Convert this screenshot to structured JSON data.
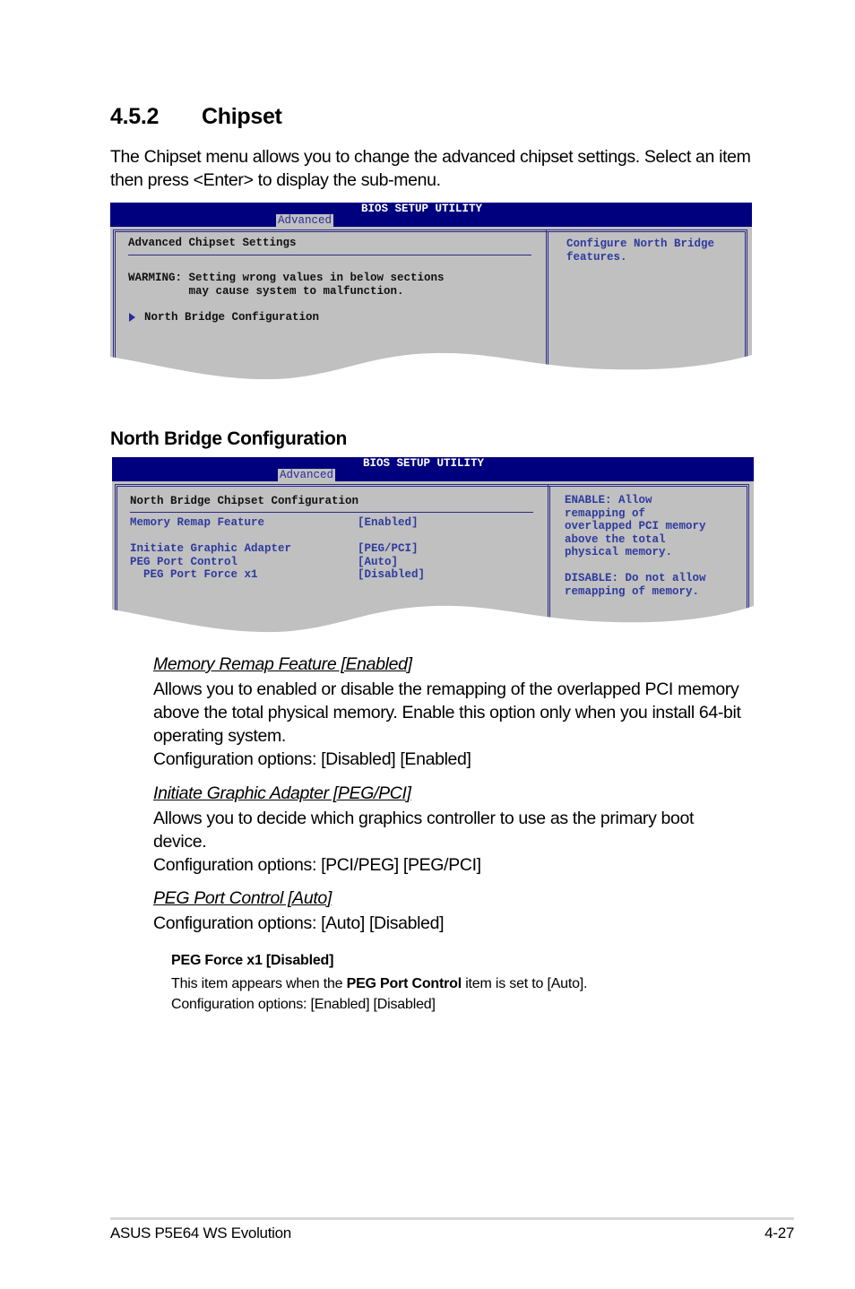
{
  "section": {
    "number": "4.5.2",
    "title": "Chipset",
    "intro": "The Chipset menu allows you to change the advanced chipset settings. Select an item then press <Enter> to display the sub-menu."
  },
  "bios1": {
    "utility_title": "BIOS SETUP UTILITY",
    "active_tab": "Advanced",
    "heading": "Advanced Chipset Settings",
    "warning_line1": "WARMING: Setting wrong values in below sections",
    "warning_line2": "         may cause system to malfunction.",
    "submenu_item": "North Bridge Configuration",
    "help_text": "Configure North Bridge\nfeatures."
  },
  "subsection": {
    "title": "North Bridge Configuration"
  },
  "bios2": {
    "utility_title": "BIOS SETUP UTILITY",
    "active_tab": "Advanced",
    "heading": "North Bridge Chipset Configuration",
    "settings": [
      {
        "label": "Memory Remap Feature",
        "value": "[Enabled]"
      },
      {
        "label": "Initiate Graphic Adapter",
        "value": "[PEG/PCI]"
      },
      {
        "label": "PEG Port Control",
        "value": "[Auto]"
      },
      {
        "label": "  PEG Port Force x1",
        "value": "[Disabled]"
      }
    ],
    "help_text": "ENABLE: Allow\nremapping of\noverlapped PCI memory\nabove the total\nphysical memory.\n\nDISABLE: Do not allow\nremapping of memory."
  },
  "items": [
    {
      "title": "Memory Remap Feature [Enabled]",
      "body": "Allows you to enabled or disable the remapping of the overlapped PCI memory above the total physical memory. Enable this option only when you install 64-bit operating system.",
      "options": "Configuration options: [Disabled] [Enabled]"
    },
    {
      "title": "Initiate Graphic Adapter [PEG/PCI]",
      "body": "Allows you to decide which graphics controller to use as the primary boot device.",
      "options": "Configuration options: [PCI/PEG] [PEG/PCI]"
    },
    {
      "title": "PEG Port Control [Auto]",
      "options": "Configuration options: [Auto] [Disabled]"
    }
  ],
  "sub_item": {
    "title": "PEG Force x1 [Disabled]",
    "body_pre": "This item appears when the ",
    "body_bold": "PEG Port Control",
    "body_post": " item is set to [Auto].",
    "options": "Configuration options: [Enabled] [Disabled]"
  },
  "footer": {
    "product": "ASUS P5E64 WS Evolution",
    "page": "4-27"
  }
}
